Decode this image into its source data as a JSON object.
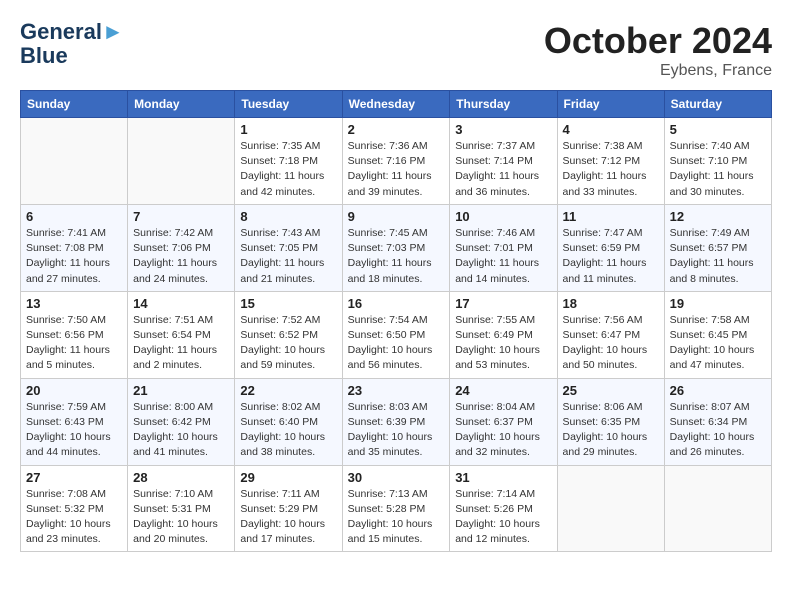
{
  "header": {
    "logo_line1": "General",
    "logo_line2": "Blue",
    "month": "October 2024",
    "location": "Eybens, France"
  },
  "columns": [
    "Sunday",
    "Monday",
    "Tuesday",
    "Wednesday",
    "Thursday",
    "Friday",
    "Saturday"
  ],
  "weeks": [
    [
      {
        "day": "",
        "info": ""
      },
      {
        "day": "",
        "info": ""
      },
      {
        "day": "1",
        "info": "Sunrise: 7:35 AM\nSunset: 7:18 PM\nDaylight: 11 hours and 42 minutes."
      },
      {
        "day": "2",
        "info": "Sunrise: 7:36 AM\nSunset: 7:16 PM\nDaylight: 11 hours and 39 minutes."
      },
      {
        "day": "3",
        "info": "Sunrise: 7:37 AM\nSunset: 7:14 PM\nDaylight: 11 hours and 36 minutes."
      },
      {
        "day": "4",
        "info": "Sunrise: 7:38 AM\nSunset: 7:12 PM\nDaylight: 11 hours and 33 minutes."
      },
      {
        "day": "5",
        "info": "Sunrise: 7:40 AM\nSunset: 7:10 PM\nDaylight: 11 hours and 30 minutes."
      }
    ],
    [
      {
        "day": "6",
        "info": "Sunrise: 7:41 AM\nSunset: 7:08 PM\nDaylight: 11 hours and 27 minutes."
      },
      {
        "day": "7",
        "info": "Sunrise: 7:42 AM\nSunset: 7:06 PM\nDaylight: 11 hours and 24 minutes."
      },
      {
        "day": "8",
        "info": "Sunrise: 7:43 AM\nSunset: 7:05 PM\nDaylight: 11 hours and 21 minutes."
      },
      {
        "day": "9",
        "info": "Sunrise: 7:45 AM\nSunset: 7:03 PM\nDaylight: 11 hours and 18 minutes."
      },
      {
        "day": "10",
        "info": "Sunrise: 7:46 AM\nSunset: 7:01 PM\nDaylight: 11 hours and 14 minutes."
      },
      {
        "day": "11",
        "info": "Sunrise: 7:47 AM\nSunset: 6:59 PM\nDaylight: 11 hours and 11 minutes."
      },
      {
        "day": "12",
        "info": "Sunrise: 7:49 AM\nSunset: 6:57 PM\nDaylight: 11 hours and 8 minutes."
      }
    ],
    [
      {
        "day": "13",
        "info": "Sunrise: 7:50 AM\nSunset: 6:56 PM\nDaylight: 11 hours and 5 minutes."
      },
      {
        "day": "14",
        "info": "Sunrise: 7:51 AM\nSunset: 6:54 PM\nDaylight: 11 hours and 2 minutes."
      },
      {
        "day": "15",
        "info": "Sunrise: 7:52 AM\nSunset: 6:52 PM\nDaylight: 10 hours and 59 minutes."
      },
      {
        "day": "16",
        "info": "Sunrise: 7:54 AM\nSunset: 6:50 PM\nDaylight: 10 hours and 56 minutes."
      },
      {
        "day": "17",
        "info": "Sunrise: 7:55 AM\nSunset: 6:49 PM\nDaylight: 10 hours and 53 minutes."
      },
      {
        "day": "18",
        "info": "Sunrise: 7:56 AM\nSunset: 6:47 PM\nDaylight: 10 hours and 50 minutes."
      },
      {
        "day": "19",
        "info": "Sunrise: 7:58 AM\nSunset: 6:45 PM\nDaylight: 10 hours and 47 minutes."
      }
    ],
    [
      {
        "day": "20",
        "info": "Sunrise: 7:59 AM\nSunset: 6:43 PM\nDaylight: 10 hours and 44 minutes."
      },
      {
        "day": "21",
        "info": "Sunrise: 8:00 AM\nSunset: 6:42 PM\nDaylight: 10 hours and 41 minutes."
      },
      {
        "day": "22",
        "info": "Sunrise: 8:02 AM\nSunset: 6:40 PM\nDaylight: 10 hours and 38 minutes."
      },
      {
        "day": "23",
        "info": "Sunrise: 8:03 AM\nSunset: 6:39 PM\nDaylight: 10 hours and 35 minutes."
      },
      {
        "day": "24",
        "info": "Sunrise: 8:04 AM\nSunset: 6:37 PM\nDaylight: 10 hours and 32 minutes."
      },
      {
        "day": "25",
        "info": "Sunrise: 8:06 AM\nSunset: 6:35 PM\nDaylight: 10 hours and 29 minutes."
      },
      {
        "day": "26",
        "info": "Sunrise: 8:07 AM\nSunset: 6:34 PM\nDaylight: 10 hours and 26 minutes."
      }
    ],
    [
      {
        "day": "27",
        "info": "Sunrise: 7:08 AM\nSunset: 5:32 PM\nDaylight: 10 hours and 23 minutes."
      },
      {
        "day": "28",
        "info": "Sunrise: 7:10 AM\nSunset: 5:31 PM\nDaylight: 10 hours and 20 minutes."
      },
      {
        "day": "29",
        "info": "Sunrise: 7:11 AM\nSunset: 5:29 PM\nDaylight: 10 hours and 17 minutes."
      },
      {
        "day": "30",
        "info": "Sunrise: 7:13 AM\nSunset: 5:28 PM\nDaylight: 10 hours and 15 minutes."
      },
      {
        "day": "31",
        "info": "Sunrise: 7:14 AM\nSunset: 5:26 PM\nDaylight: 10 hours and 12 minutes."
      },
      {
        "day": "",
        "info": ""
      },
      {
        "day": "",
        "info": ""
      }
    ]
  ]
}
